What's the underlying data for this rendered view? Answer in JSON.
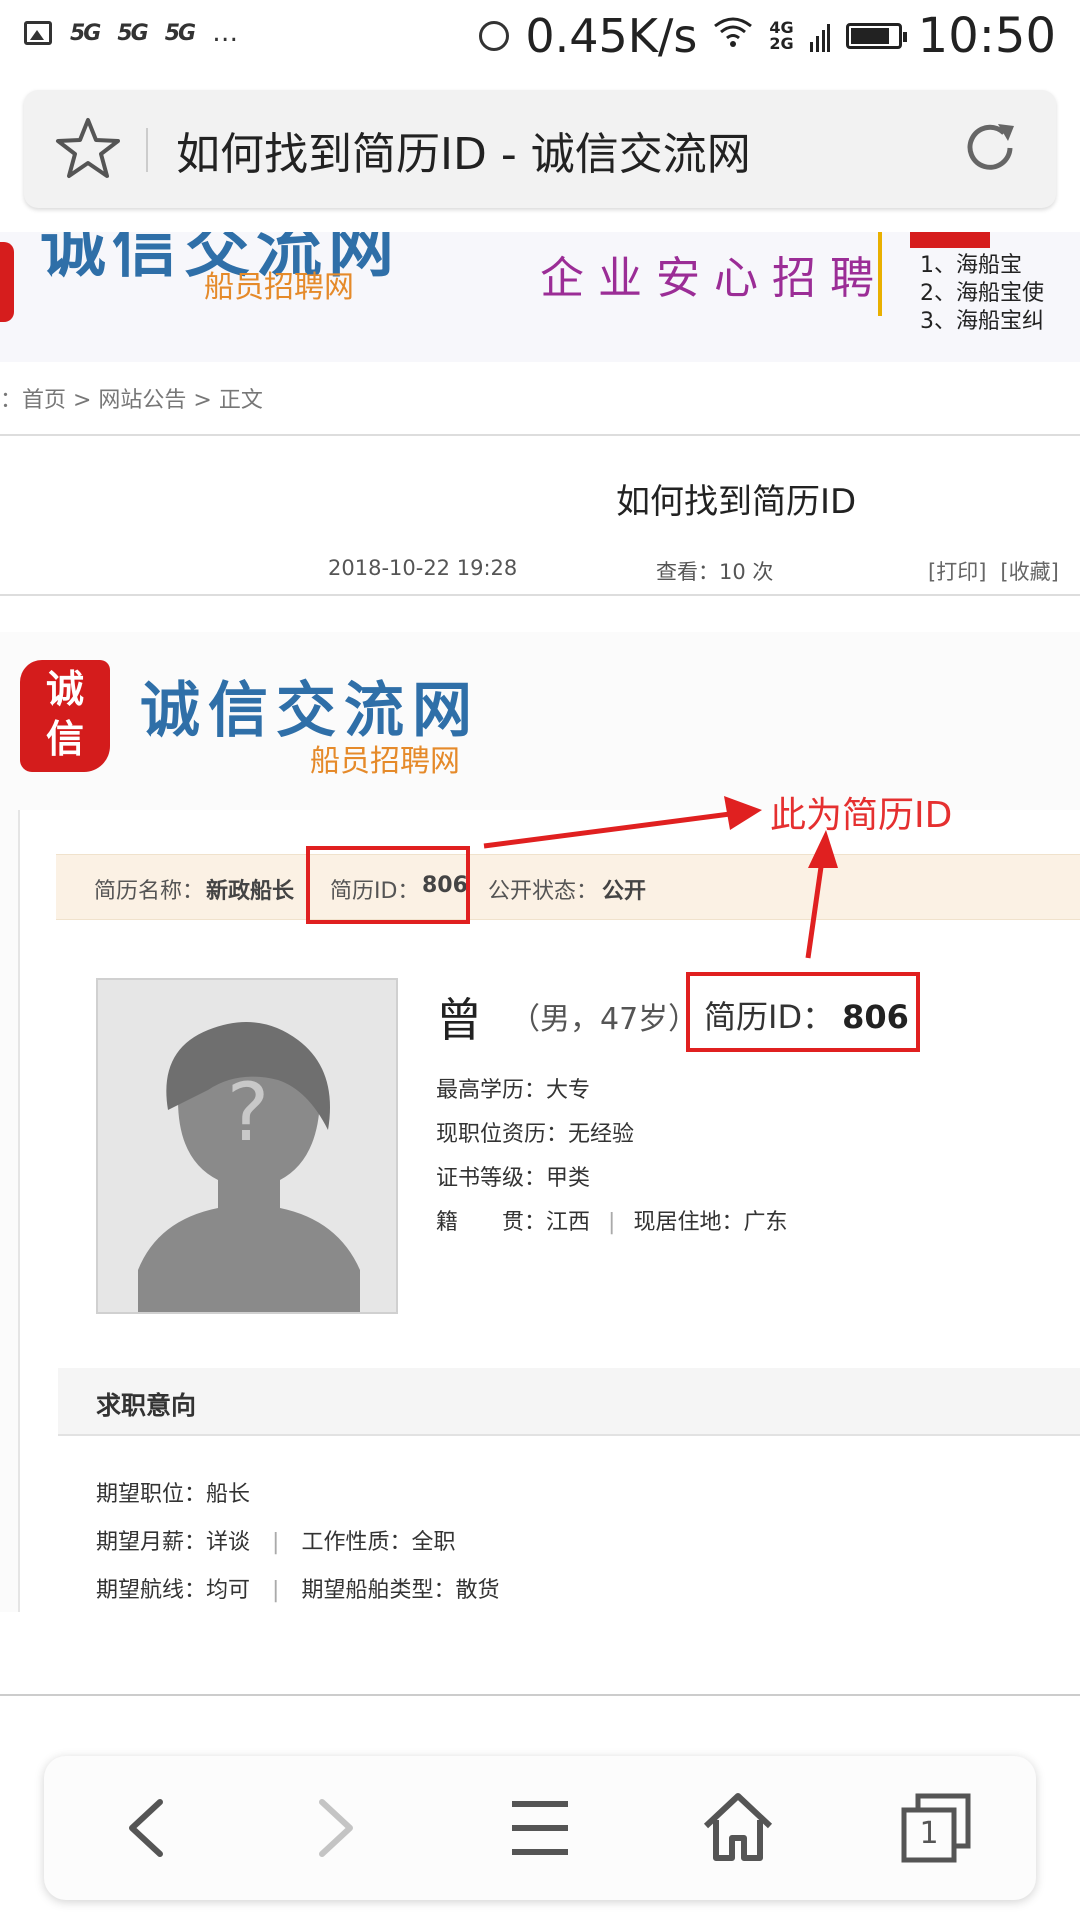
{
  "status_bar": {
    "sim_labels": [
      "5G",
      "5G",
      "5G"
    ],
    "overflow": "…",
    "speed": "0.45K/s",
    "network": "4G\n2G",
    "time": "10:50"
  },
  "address_bar": {
    "title": "如何找到简历ID - 诚信交流网"
  },
  "banner": {
    "logo_text": "诚信交流网",
    "logo_sub": "船员招聘网",
    "slogan": "企业安心招聘",
    "notices": [
      "1、海船宝",
      "2、海船宝使",
      "3、海船宝纠"
    ]
  },
  "breadcrumb": "：首页 > 网站公告 > 正文",
  "article": {
    "title": "如何找到简历ID",
    "date": "2018-10-22 19:28",
    "views": "查看：10 次",
    "print": "[打印]",
    "favorite": "[收藏]"
  },
  "screenshot": {
    "seal_text": "诚信",
    "logo_text": "诚信交流网",
    "logo_sub": "船员招聘网",
    "annotation": "此为简历ID",
    "info_bar": {
      "name_label": "简历名称：",
      "name_value": "新政船长",
      "id_label": "简历ID：",
      "id_value": "806",
      "status_label": "公开状态：",
      "status_value": "公开"
    },
    "profile": {
      "surname": "曾",
      "gender_age": "（男，47岁）",
      "id_label": "简历ID：",
      "id_value": "806",
      "education": "最高学历：大专",
      "experience": "现职位资历：无经验",
      "certificate": "证书等级：甲类",
      "hometown": "籍　　贯：江西",
      "residence": "现居住地：广东"
    },
    "intent": {
      "section_title": "求职意向",
      "position": "期望职位：船长",
      "salary": "期望月薪：详谈",
      "job_type": "工作性质：全职",
      "route": "期望航线：均可",
      "ship_type": "期望船舶类型：散货"
    }
  },
  "nav": {
    "tab_count": "1"
  }
}
